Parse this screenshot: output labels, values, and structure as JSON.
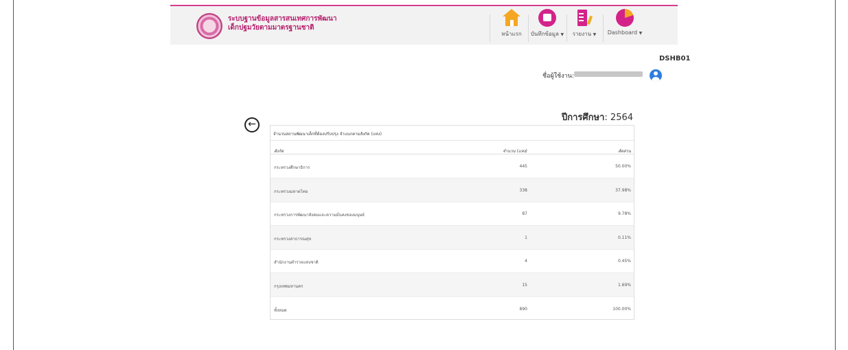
{
  "app": {
    "title_line1": "ระบบฐานข้อมูลสารสนเทศการพัฒนา",
    "title_line2": "เด็กปฐมวัยตามมาตรฐานชาติ"
  },
  "nav": {
    "home": "หน้าแรก",
    "record": "บันทึกข้อมูล",
    "report": "รายงาน",
    "dashboard": "Dashboard"
  },
  "page": {
    "code": "DSHB01",
    "user_label": "ชื่อผู้ใช้งาน:",
    "year_label": "ปีการศึกษา",
    "year_value": ": 2564"
  },
  "table": {
    "title": "จำนวนสถานพัฒนาเด็กที่ต้องปรับปรุง จำแนกตามสังกัด (แห่ง)",
    "headers": [
      "สังกัด",
      "จำนวน (แห่ง)",
      "สัดส่วน"
    ],
    "rows": [
      {
        "name": "กระทรวงศึกษาธิการ",
        "count": "445",
        "pct": "50.00%"
      },
      {
        "name": "กระทรวงมหาดไทย",
        "count": "338",
        "pct": "37.98%"
      },
      {
        "name": "กระทรวงการพัฒนาสังคมและความมั่นคงของมนุษย์",
        "count": "87",
        "pct": "9.78%"
      },
      {
        "name": "กระทรวงสาธารณสุข",
        "count": "1",
        "pct": "0.11%"
      },
      {
        "name": "สำนักงานตำรวจแห่งชาติ",
        "count": "4",
        "pct": "0.45%"
      },
      {
        "name": "กรุงเทพมหานคร",
        "count": "15",
        "pct": "1.69%"
      },
      {
        "name": "ทั้งหมด",
        "count": "890",
        "pct": "100.00%"
      }
    ]
  }
}
